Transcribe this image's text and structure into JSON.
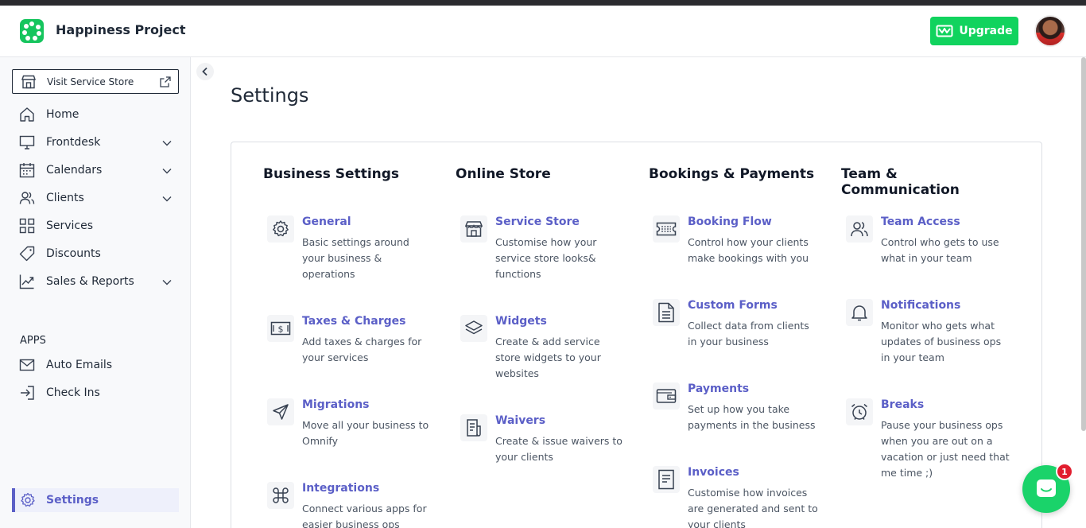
{
  "header": {
    "app_title": "Happiness Project",
    "upgrade_label": "Upgrade",
    "brand_color": "#11d35e"
  },
  "sidebar": {
    "visit_label": "Visit Service Store",
    "items": [
      {
        "label": "Home",
        "icon": "home-icon",
        "expandable": false
      },
      {
        "label": "Frontdesk",
        "icon": "monitor-icon",
        "expandable": true
      },
      {
        "label": "Calendars",
        "icon": "calendar-icon",
        "expandable": true
      },
      {
        "label": "Clients",
        "icon": "users-icon",
        "expandable": true
      },
      {
        "label": "Services",
        "icon": "grid-icon",
        "expandable": false
      },
      {
        "label": "Discounts",
        "icon": "tag-icon",
        "expandable": false
      },
      {
        "label": "Sales & Reports",
        "icon": "chart-icon",
        "expandable": true
      }
    ],
    "apps_label": "APPS",
    "apps": [
      {
        "label": "Auto Emails",
        "icon": "mail-icon"
      },
      {
        "label": "Check Ins",
        "icon": "login-icon"
      }
    ],
    "active_item": {
      "label": "Settings",
      "icon": "gear-icon"
    }
  },
  "main": {
    "title": "Settings",
    "columns": [
      {
        "title": "Business Settings",
        "items": [
          {
            "title": "General",
            "desc": "Basic settings around your business & operations",
            "icon": "gear-icon"
          },
          {
            "title": "Taxes & Charges",
            "desc": "Add taxes & charges for your services",
            "icon": "money-icon"
          },
          {
            "title": "Migrations",
            "desc": "Move all your business to Omnify",
            "icon": "send-icon"
          },
          {
            "title": "Integrations",
            "desc": "Connect various apps for easier business ops",
            "icon": "command-icon"
          }
        ]
      },
      {
        "title": "Online Store",
        "items": [
          {
            "title": "Service Store",
            "desc": "Customise how your service store looks& functions",
            "icon": "store-icon"
          },
          {
            "title": "Widgets",
            "desc": "Create & add service store widgets to your websites",
            "icon": "layers-icon"
          },
          {
            "title": "Waivers",
            "desc": "Create & issue waivers to your clients",
            "icon": "document-icon"
          }
        ]
      },
      {
        "title": "Bookings & Payments",
        "items": [
          {
            "title": "Booking Flow",
            "desc": "Control how your clients make bookings with you",
            "icon": "ticket-icon"
          },
          {
            "title": "Custom Forms",
            "desc": "Collect data from clients in your business",
            "icon": "form-icon"
          },
          {
            "title": "Payments",
            "desc": "Set up how you take payments in the business",
            "icon": "wallet-icon"
          },
          {
            "title": "Invoices",
            "desc": "Customise how invoices are generated and sent to your clients",
            "icon": "invoice-icon"
          }
        ]
      },
      {
        "title": "Team & Communication",
        "items": [
          {
            "title": "Team Access",
            "desc": "Control who gets to use what in your team",
            "icon": "team-icon"
          },
          {
            "title": "Notifications",
            "desc": "Monitor who gets what updates of business ops in your team",
            "icon": "bell-icon"
          },
          {
            "title": "Breaks",
            "desc": "Pause your business ops when you are out on a vacation or just need that me time ;)",
            "icon": "alarm-icon"
          }
        ]
      }
    ]
  },
  "chat": {
    "badge_count": "1"
  }
}
